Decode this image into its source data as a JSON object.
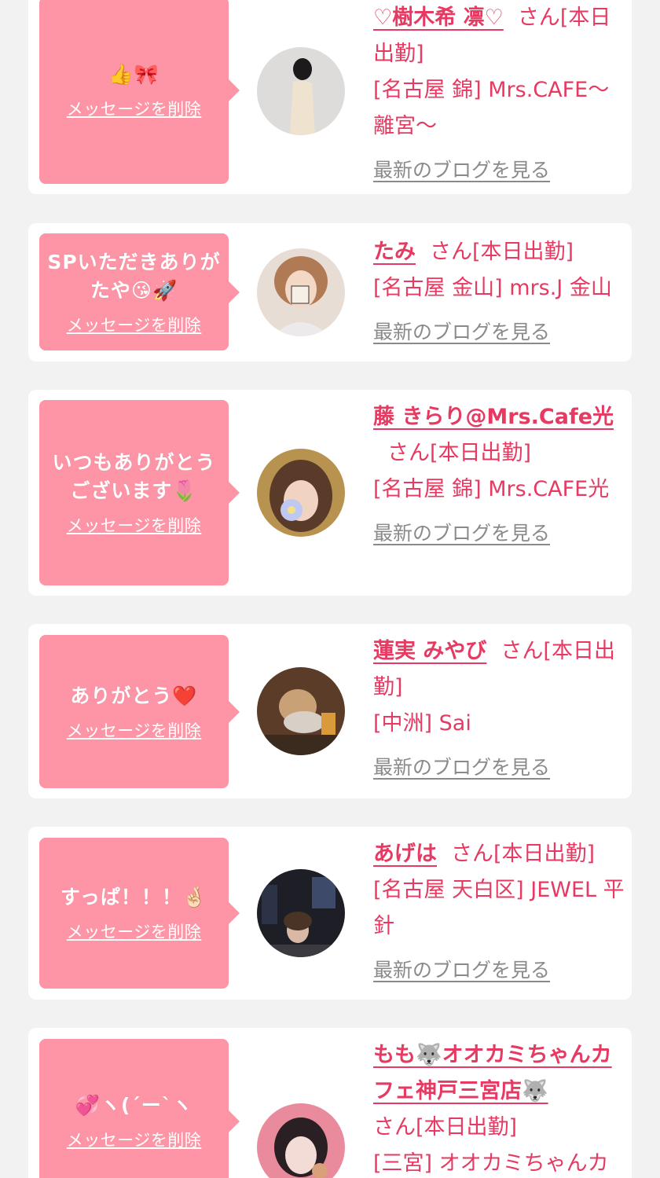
{
  "colors": {
    "accent": "#e63a62",
    "bubble": "#fd95a6",
    "background": "#f2f2f2"
  },
  "messages": [
    {
      "bubble_text": "👍🎀",
      "delete_label": "メッセージを削除",
      "name": "♡樹木希 凛♡",
      "san": "さん",
      "status": "[本日出勤]",
      "shop": "[名古屋 錦] Mrs.CAFE〜離宮〜",
      "blog": "最新のブログを見る"
    },
    {
      "bubble_text": "SPいただきありがたや😘🚀",
      "delete_label": "メッセージを削除",
      "name": "たみ",
      "san": "さん",
      "status": "[本日出勤]",
      "shop": "[名古屋 金山] mrs.J 金山",
      "blog": "最新のブログを見る"
    },
    {
      "bubble_text": "いつもありがとうございます🌷",
      "delete_label": "メッセージを削除",
      "name": "藤 きらり@Mrs.Cafe光",
      "san": "さん",
      "status": "[本日出勤]",
      "shop": "[名古屋 錦] Mrs.CAFE光",
      "blog": "最新のブログを見る"
    },
    {
      "bubble_text": "ありがとう❤️",
      "delete_label": "メッセージを削除",
      "name": "蓮実 みやび",
      "san": "さん",
      "status": "[本日出勤]",
      "shop": "[中洲] Sai",
      "blog": "最新のブログを見る"
    },
    {
      "bubble_text": "すっぱ！！！🤞🏻",
      "delete_label": "メッセージを削除",
      "name": "あげは",
      "san": "さん",
      "status": "[本日出勤]",
      "shop": "[名古屋 天白区] JEWEL 平針",
      "blog": "最新のブログを見る"
    },
    {
      "bubble_text": "💞ヽ(´ー`ヽ",
      "delete_label": "メッセージを削除",
      "name": "もも🐺オオカミちゃんカフェ神戸三宮店🐺",
      "san": "さん",
      "status": "[本日出勤]",
      "shop": "[三宮] オオカミちゃんカフェ"
    }
  ]
}
